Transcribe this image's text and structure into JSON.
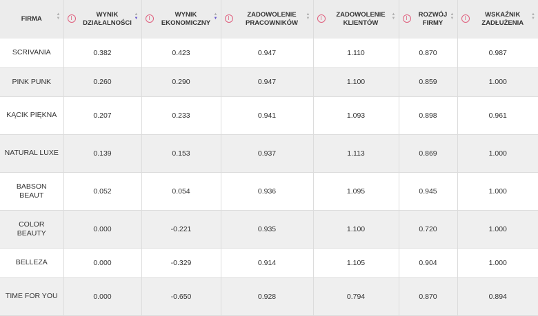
{
  "headers": [
    {
      "label": "FIRMA"
    },
    {
      "label": "WYNIK DZIAŁALNOŚCI"
    },
    {
      "label": "WYNIK EKONOMICZNY"
    },
    {
      "label": "ZADOWOLENIE PRACOWNIKÓW"
    },
    {
      "label": "ZADOWOLENIE KLIENTÓW"
    },
    {
      "label": "ROZWÓJ FIRMY"
    },
    {
      "label": "WSKAŹNIK ZADŁUŻENIA"
    }
  ],
  "info_glyph": "i",
  "sort_glyphs": {
    "up": "▲",
    "down": "▼"
  },
  "accent_colors": {
    "info": "#e0607e",
    "sort_active": "#6a5acd"
  },
  "rows": [
    {
      "firm": "SCRIVANIA",
      "values": [
        "0.382",
        "0.423",
        "0.947",
        "1.110",
        "0.870",
        "0.987"
      ]
    },
    {
      "firm": "PINK PUNK",
      "values": [
        "0.260",
        "0.290",
        "0.947",
        "1.100",
        "0.859",
        "1.000"
      ]
    },
    {
      "firm": "KĄCIK PIĘKNA",
      "values": [
        "0.207",
        "0.233",
        "0.941",
        "1.093",
        "0.898",
        "0.961"
      ]
    },
    {
      "firm": "NATURAL LUXE",
      "values": [
        "0.139",
        "0.153",
        "0.937",
        "1.113",
        "0.869",
        "1.000"
      ]
    },
    {
      "firm": "BABSON BEAUT",
      "values": [
        "0.052",
        "0.054",
        "0.936",
        "1.095",
        "0.945",
        "1.000"
      ]
    },
    {
      "firm": "COLOR BEAUTY",
      "values": [
        "0.000",
        "-0.221",
        "0.935",
        "1.100",
        "0.720",
        "1.000"
      ]
    },
    {
      "firm": "BELLEZA",
      "values": [
        "0.000",
        "-0.329",
        "0.914",
        "1.105",
        "0.904",
        "1.000"
      ]
    },
    {
      "firm": "TIME FOR YOU",
      "values": [
        "0.000",
        "-0.650",
        "0.928",
        "0.794",
        "0.870",
        "0.894"
      ]
    }
  ]
}
